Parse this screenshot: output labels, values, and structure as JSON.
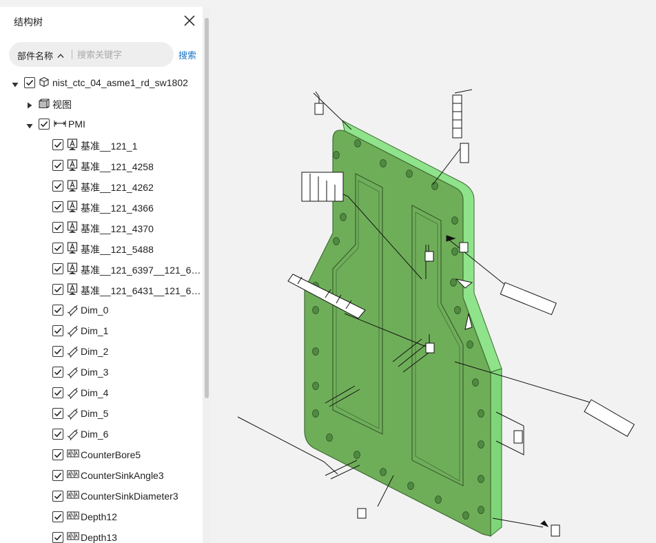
{
  "panel": {
    "title": "结构树",
    "search": {
      "field_label": "部件名称",
      "placeholder": "搜索关键字",
      "button_label": "搜索"
    }
  },
  "tree": [
    {
      "label": "nist_ctc_04_asme1_rd_sw1802",
      "level": 0,
      "expanded": true,
      "checkbox": true,
      "icon": "cube-outline-icon"
    },
    {
      "label": "视图",
      "level": 1,
      "expanded": false,
      "checkbox": false,
      "icon": "cube-solid-icon"
    },
    {
      "label": "PMI",
      "level": 1,
      "expanded": true,
      "checkbox": true,
      "icon": "dimension-icon"
    },
    {
      "label": "基准__121_1",
      "level": 2,
      "checkbox": true,
      "icon": "datum-icon"
    },
    {
      "label": "基准__121_4258",
      "level": 2,
      "checkbox": true,
      "icon": "datum-icon"
    },
    {
      "label": "基准__121_4262",
      "level": 2,
      "checkbox": true,
      "icon": "datum-icon"
    },
    {
      "label": "基准__121_4366",
      "level": 2,
      "checkbox": true,
      "icon": "datum-icon"
    },
    {
      "label": "基准__121_4370",
      "level": 2,
      "checkbox": true,
      "icon": "datum-icon"
    },
    {
      "label": "基准__121_5488",
      "level": 2,
      "checkbox": true,
      "icon": "datum-icon"
    },
    {
      "label": "基准__121_6397__121_6…",
      "level": 2,
      "checkbox": true,
      "icon": "datum-icon"
    },
    {
      "label": "基准__121_6431__121_6…",
      "level": 2,
      "checkbox": true,
      "icon": "datum-icon"
    },
    {
      "label": "Dim_0",
      "level": 2,
      "checkbox": true,
      "icon": "dim-icon"
    },
    {
      "label": "Dim_1",
      "level": 2,
      "checkbox": true,
      "icon": "dim-icon"
    },
    {
      "label": "Dim_2",
      "level": 2,
      "checkbox": true,
      "icon": "dim-icon"
    },
    {
      "label": "Dim_3",
      "level": 2,
      "checkbox": true,
      "icon": "dim-icon"
    },
    {
      "label": "Dim_4",
      "level": 2,
      "checkbox": true,
      "icon": "dim-icon"
    },
    {
      "label": "Dim_5",
      "level": 2,
      "checkbox": true,
      "icon": "dim-icon"
    },
    {
      "label": "Dim_6",
      "level": 2,
      "checkbox": true,
      "icon": "dim-icon"
    },
    {
      "label": "CounterBore5",
      "level": 2,
      "checkbox": true,
      "icon": "feature-icon"
    },
    {
      "label": "CounterSinkAngle3",
      "level": 2,
      "checkbox": true,
      "icon": "feature-icon"
    },
    {
      "label": "CounterSinkDiameter3",
      "level": 2,
      "checkbox": true,
      "icon": "feature-icon"
    },
    {
      "label": "Depth12",
      "level": 2,
      "checkbox": true,
      "icon": "feature-icon"
    },
    {
      "label": "Depth13",
      "level": 2,
      "checkbox": true,
      "icon": "feature-icon"
    }
  ],
  "viewport": {
    "model_color": "#6fae59",
    "model_edge_color": "#3f6b33",
    "model_highlight_color": "#90ee90",
    "background": "#f2f2f2"
  }
}
